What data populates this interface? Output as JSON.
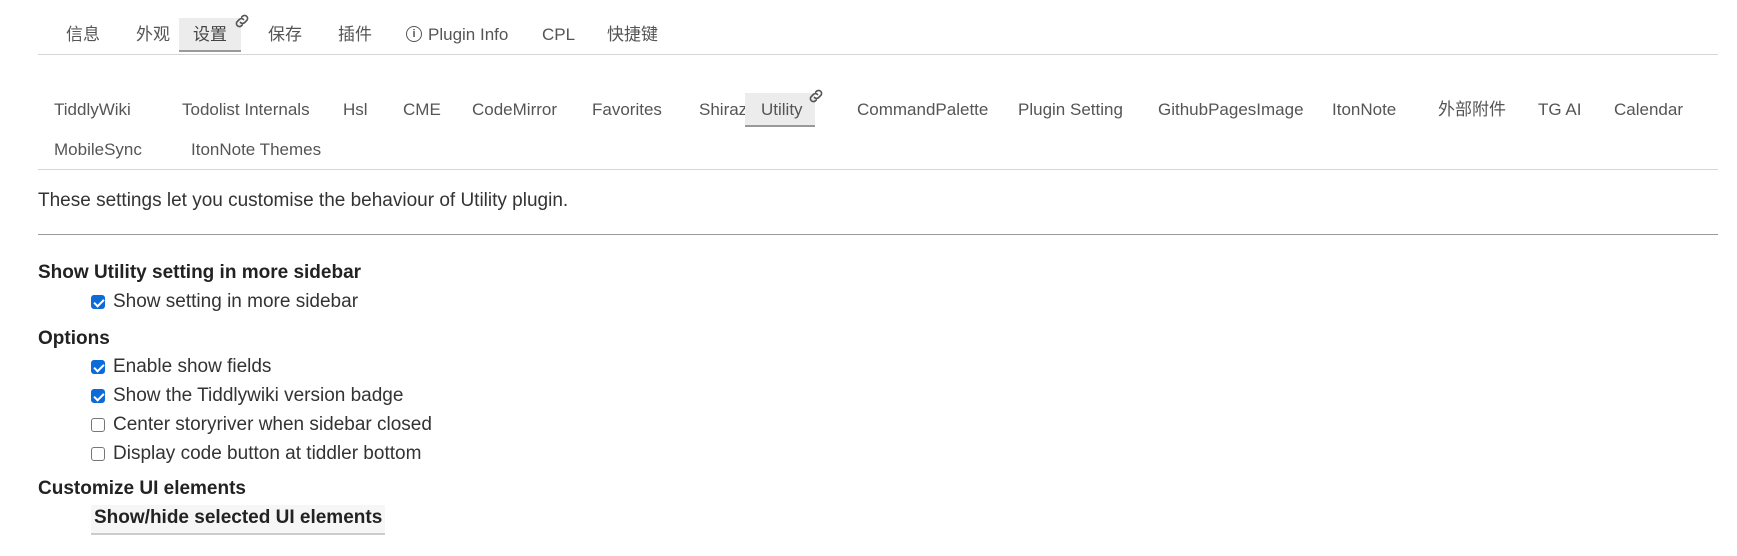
{
  "top_tabs": [
    {
      "label": "信息"
    },
    {
      "label": "外观"
    },
    {
      "label": "设置"
    },
    {
      "label": "保存"
    },
    {
      "label": "插件"
    },
    {
      "label": "Plugin Info"
    },
    {
      "label": "CPL"
    },
    {
      "label": "快捷键"
    }
  ],
  "active_top_tab": "设置",
  "sub_tabs": [
    {
      "label": "TiddlyWiki"
    },
    {
      "label": "Todolist Internals"
    },
    {
      "label": "Hsl"
    },
    {
      "label": "CME"
    },
    {
      "label": "CodeMirror"
    },
    {
      "label": "Favorites"
    },
    {
      "label": "Shiraz"
    },
    {
      "label": "Utility"
    },
    {
      "label": "CommandPalette"
    },
    {
      "label": "Plugin Setting"
    },
    {
      "label": "GithubPagesImage"
    },
    {
      "label": "ItonNote"
    },
    {
      "label": "外部附件"
    },
    {
      "label": "TG AI"
    },
    {
      "label": "Calendar"
    },
    {
      "label": "MobileSync"
    },
    {
      "label": "ItonNote Themes"
    }
  ],
  "active_sub_tab": "Utility",
  "description": "These settings let you customise the behaviour of Utility plugin.",
  "sections": {
    "sidebar": {
      "title": "Show Utility setting in more sidebar",
      "options": [
        {
          "label": "Show setting in more sidebar",
          "checked": true
        }
      ]
    },
    "options": {
      "title": "Options",
      "options": [
        {
          "label": "Enable show fields",
          "checked": true
        },
        {
          "label": "Show the Tiddlywiki version badge",
          "checked": true
        },
        {
          "label": "Center storyriver when sidebar closed",
          "checked": false
        },
        {
          "label": "Display code button at tiddler bottom",
          "checked": false
        }
      ]
    },
    "customize": {
      "title": "Customize UI elements",
      "button_label": "Show/hide selected UI elements"
    }
  },
  "colors": {
    "checkbox_checked": "#0b6bd8",
    "active_tab_bg": "#ececec"
  },
  "icons": {
    "tab_link": "link-icon",
    "plugin_info": "info-icon"
  }
}
